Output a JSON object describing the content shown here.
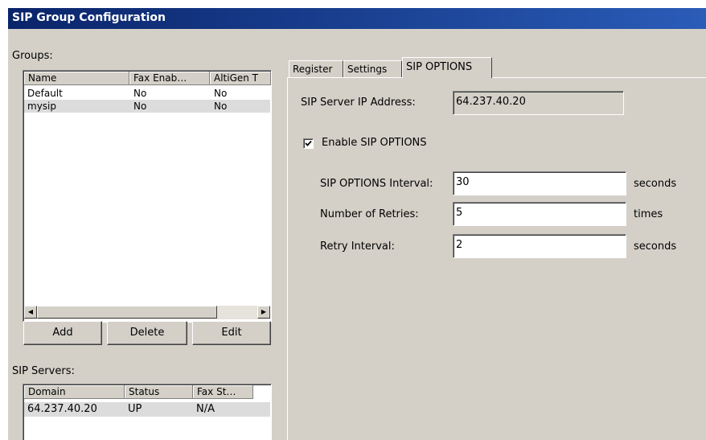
{
  "window": {
    "title": "SIP Group Configuration"
  },
  "groups": {
    "label": "Groups:",
    "columns": [
      "Name",
      "Fax Enab…",
      "AltiGen T"
    ],
    "rows": [
      [
        "Default",
        "No",
        "No"
      ],
      [
        "mysip",
        "No",
        "No"
      ]
    ],
    "selected_row": 1
  },
  "buttons": {
    "add": "Add",
    "delete": "Delete",
    "edit": "Edit"
  },
  "sip_servers": {
    "label": "SIP Servers:",
    "columns": [
      "Domain",
      "Status",
      "Fax St…"
    ],
    "rows": [
      [
        "64.237.40.20",
        "UP",
        "N/A"
      ]
    ]
  },
  "tabs": [
    "Register",
    "Settings",
    "SIP OPTIONS"
  ],
  "active_tab": "SIP OPTIONS",
  "form": {
    "server_ip_label": "SIP Server IP Address:",
    "server_ip_value": "64.237.40.20",
    "enable_label": "Enable SIP OPTIONS",
    "enable_checked": true,
    "interval_label": "SIP OPTIONS Interval:",
    "interval_value": "30",
    "interval_unit": "seconds",
    "retries_label": "Number of Retries:",
    "retries_value": "5",
    "retries_unit": "times",
    "retry_interval_label": "Retry Interval:",
    "retry_interval_value": "2",
    "retry_interval_unit": "seconds"
  },
  "colors": {
    "titlebar": "#0a246a",
    "dialog": "#d4d0c8",
    "selection": "#dcdcdc"
  },
  "icons": [
    "checkmark-icon",
    "scroll-left-arrow-icon",
    "scroll-right-arrow-icon"
  ]
}
